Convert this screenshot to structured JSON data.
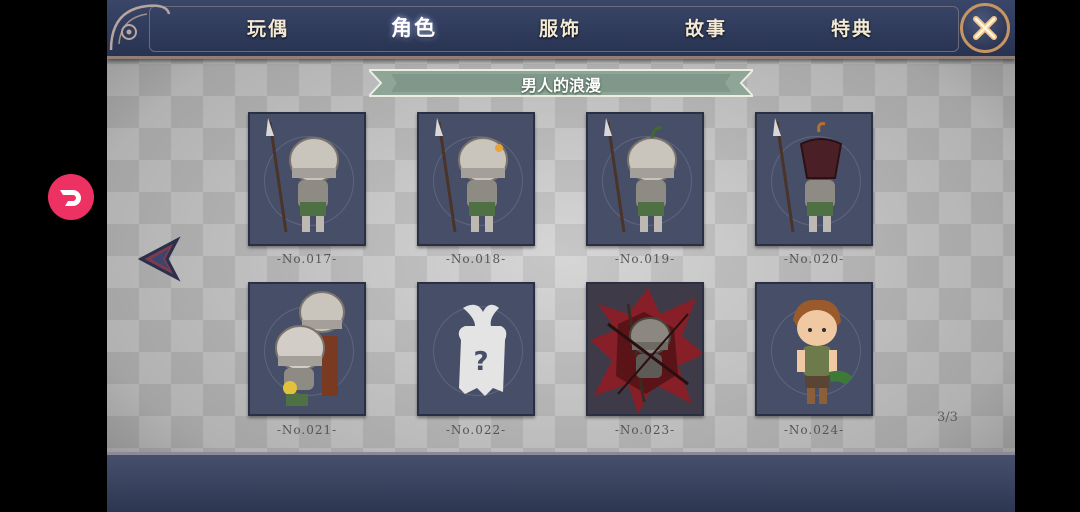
{
  "tabs": [
    {
      "label": "玩偶",
      "active": false
    },
    {
      "label": "角色",
      "active": true
    },
    {
      "label": "服饰",
      "active": false
    },
    {
      "label": "故事",
      "active": false
    },
    {
      "label": "特典",
      "active": false
    }
  ],
  "section_title": "男人的浪漫",
  "cards": [
    {
      "number": "-No.017-",
      "state": "unlocked"
    },
    {
      "number": "-No.018-",
      "state": "unlocked"
    },
    {
      "number": "-No.019-",
      "state": "unlocked"
    },
    {
      "number": "-No.020-",
      "state": "unlocked"
    },
    {
      "number": "-No.021-",
      "state": "unlocked"
    },
    {
      "number": "-No.022-",
      "state": "locked"
    },
    {
      "number": "-No.023-",
      "state": "unlocked"
    },
    {
      "number": "-No.024-",
      "state": "unlocked"
    }
  ],
  "pagination": "3/3",
  "colors": {
    "accent": "#ee3163",
    "bar": "#2f3a5a",
    "banner": "#8fa596"
  },
  "icons": {
    "close": "close-icon",
    "back": "back-arrow-icon",
    "overlay": "overlay-app-icon"
  }
}
